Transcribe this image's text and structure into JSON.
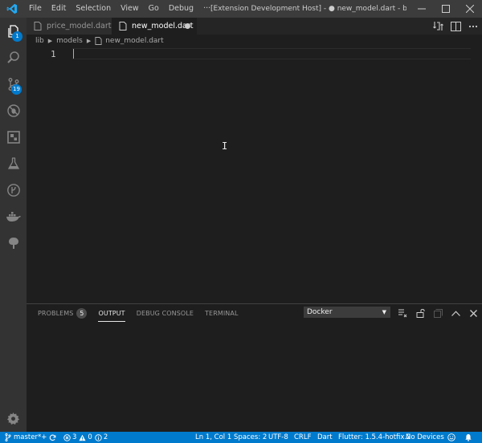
{
  "titlebar": {
    "menu": [
      "File",
      "Edit",
      "Selection",
      "View",
      "Go",
      "Debug",
      "···"
    ],
    "window_title": "[Extension Development Host] - ● new_model.dart - bitcoin - Visua…"
  },
  "activity": {
    "explorer_badge": "1",
    "scm_badge": "19"
  },
  "tabs": {
    "inactive_label": "price_model.dart",
    "active_label": "new_model.dart"
  },
  "breadcrumb": [
    "lib",
    "models",
    "new_model.dart"
  ],
  "editor": {
    "line_number": "1"
  },
  "panel": {
    "tabs": {
      "problems": "PROBLEMS",
      "problems_count": "5",
      "output": "OUTPUT",
      "debug_console": "DEBUG CONSOLE",
      "terminal": "TERMINAL"
    },
    "output_channel": "Docker"
  },
  "statusbar": {
    "branch": "master*+",
    "errors": "3",
    "warnings": "0",
    "infos": "2",
    "position": "Ln 1, Col 1",
    "spaces": "Spaces: 2",
    "encoding": "UTF-8",
    "eol": "CRLF",
    "language": "Dart",
    "flutter": "Flutter: 1.5.4-hotfix.2",
    "devices": "No Devices"
  },
  "colors": {
    "accent": "#007acc",
    "activity_bar": "#333333",
    "editor_bg": "#1e1e1e",
    "titlebar": "#3c3c3c"
  }
}
